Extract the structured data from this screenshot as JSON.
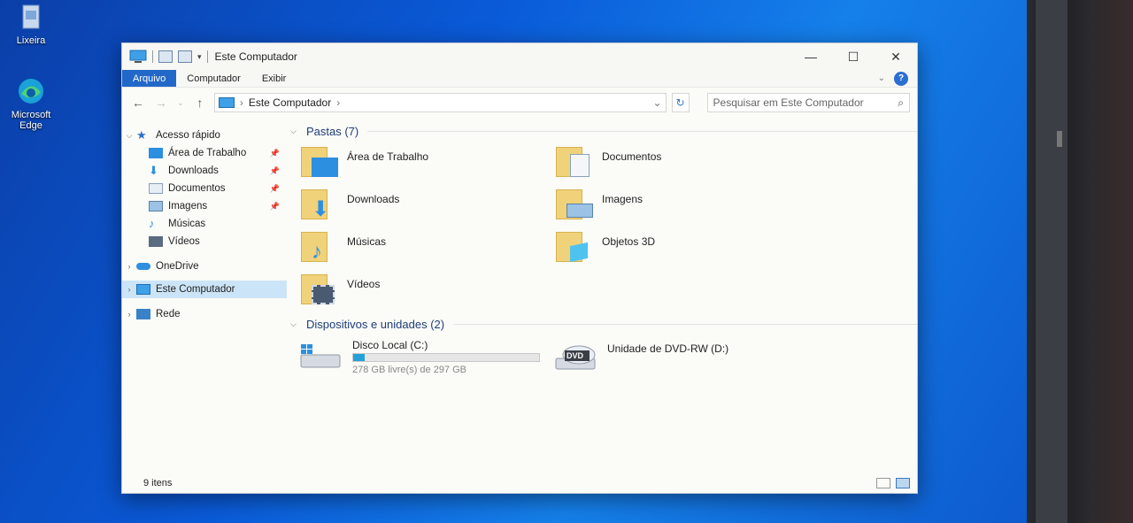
{
  "desktop": {
    "icons": [
      {
        "label": "Lixeira",
        "icon": "recycle-bin-icon"
      },
      {
        "label": "Microsoft Edge",
        "icon": "edge-icon"
      }
    ]
  },
  "window": {
    "title": "Este Computador",
    "controls": {
      "minimize": "—",
      "maximize": "☐",
      "close": "✕"
    }
  },
  "ribbon": {
    "tabs": [
      "Arquivo",
      "Computador",
      "Exibir"
    ],
    "help": "?"
  },
  "address": {
    "path": "Este Computador",
    "search_placeholder": "Pesquisar em Este Computador"
  },
  "navpane": {
    "quick_access": "Acesso rápido",
    "quick_items": [
      "Área de Trabalho",
      "Downloads",
      "Documentos",
      "Imagens",
      "Músicas",
      "Vídeos"
    ],
    "onedrive": "OneDrive",
    "this_pc": "Este Computador",
    "network": "Rede"
  },
  "content": {
    "folders_header": "Pastas (7)",
    "folders": [
      "Área de Trabalho",
      "Documentos",
      "Downloads",
      "Imagens",
      "Músicas",
      "Objetos 3D",
      "Vídeos"
    ],
    "devices_header": "Dispositivos e unidades (2)",
    "drive_c": {
      "name": "Disco Local (C:)",
      "free_text": "278 GB livre(s) de 297 GB",
      "used_fraction": 0.064
    },
    "drive_d": {
      "name": "Unidade de DVD-RW (D:)",
      "badge": "DVD"
    }
  },
  "status": {
    "items": "9 itens"
  },
  "colors": {
    "accent": "#2268c9",
    "selection": "#cce4f7",
    "folder": "#f0d27a",
    "drive_fill": "#26a0da"
  }
}
